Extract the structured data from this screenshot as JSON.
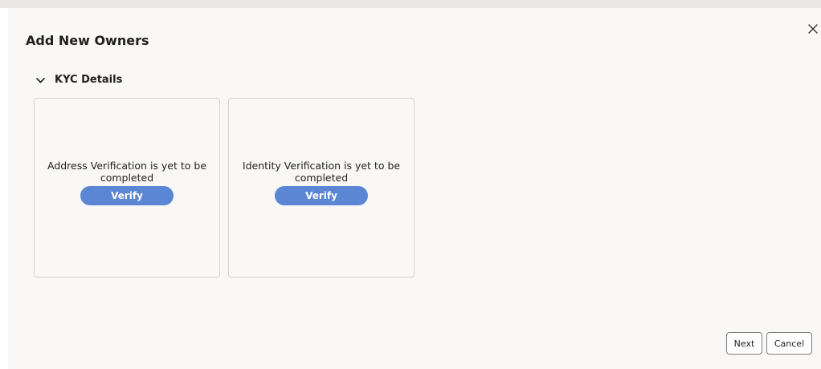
{
  "dialog": {
    "title": "Add New Owners",
    "close_icon": "close-icon"
  },
  "section": {
    "label": "KYC Details",
    "expanded": true,
    "icon": "chevron-down-icon"
  },
  "cards": [
    {
      "message": "Address Verification is yet to be completed",
      "button_label": "Verify"
    },
    {
      "message": "Identity Verification is yet to be completed",
      "button_label": "Verify"
    }
  ],
  "footer": {
    "next_label": "Next",
    "cancel_label": "Cancel"
  },
  "colors": {
    "accent": "#5b86d4",
    "dialog_bg": "#f9f8f6",
    "card_border": "#d6d4cf"
  }
}
